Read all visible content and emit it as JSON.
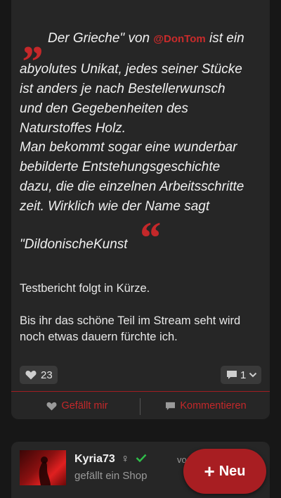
{
  "post": {
    "quote_line1_prefix": "Der Grieche\" von",
    "quote_mention": "@DonTom",
    "quote_line1_suffix": "ist ein",
    "quote_lines": [
      "abyolutes Unikat, jedes seiner Stücke",
      "ist anders je nach Bestellerwunsch",
      "und den Gegebenheiten des",
      "Naturstoffes Holz.",
      "Man bekommt sogar eine wunderbar",
      "bebilderte Entstehungsgeschichte",
      "dazu, die die einzelnen Arbeitsschritte",
      "zeit. Wirklich wie der Name sagt"
    ],
    "quote_last": "\"DildonischeKunst",
    "paragraph1": "Testbericht folgt in Kürze.",
    "paragraph2_line1": "Bis ihr das schöne Teil im Stream seht wird",
    "paragraph2_line2": "noch etwas dauern fürchte ich.",
    "likes_count": "23",
    "comments_count": "1",
    "like_label": "Gefällt mir",
    "comment_label": "Kommentieren",
    "accent_color": "#c4282a"
  },
  "next_post": {
    "username": "Kyria73",
    "action_text": "gefällt ein Shop",
    "time_fragment": "vo"
  },
  "fab": {
    "label": "Neu"
  }
}
